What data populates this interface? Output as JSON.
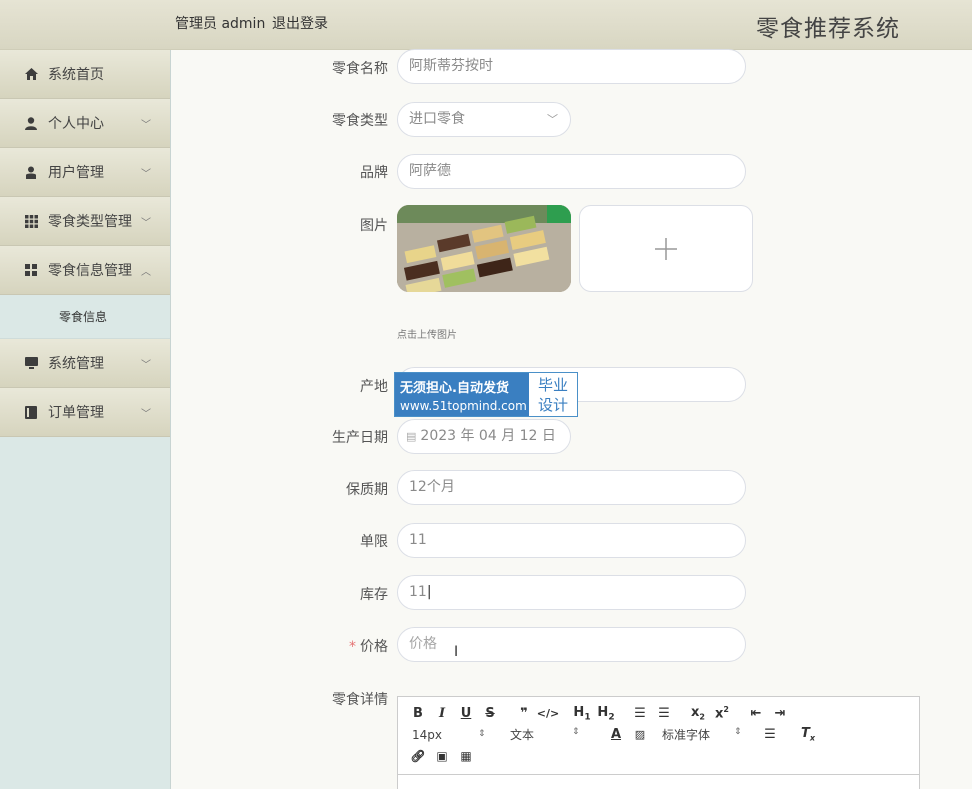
{
  "header": {
    "user_text": "管理员 admin",
    "logout_label": "退出登录",
    "system_title": "零食推荐系统"
  },
  "sidebar": {
    "items": [
      {
        "label": "系统首页",
        "icon": "home-icon"
      },
      {
        "label": "个人中心",
        "icon": "user-icon"
      },
      {
        "label": "用户管理",
        "icon": "user-manage-icon"
      },
      {
        "label": "零食类型管理",
        "icon": "grid-icon"
      },
      {
        "label": "零食信息管理",
        "icon": "grid2-icon"
      },
      {
        "label": "系统管理",
        "icon": "monitor-icon"
      },
      {
        "label": "订单管理",
        "icon": "book-icon"
      }
    ],
    "submenu_label": "零食信息"
  },
  "form": {
    "name_label": "零食名称",
    "name_value": "阿斯蒂芬按时",
    "type_label": "零食类型",
    "type_value": "进口零食",
    "brand_label": "品牌",
    "brand_value": "阿萨德",
    "image_label": "图片",
    "upload_tip": "点击上传图片",
    "origin_label": "产地",
    "date_label": "生产日期",
    "date_value": "2023 年 04 月 12 日",
    "shelf_label": "保质期",
    "shelf_value": "12个月",
    "limit_label": "单限",
    "limit_value": "11",
    "stock_label": "库存",
    "stock_value": "11",
    "price_required_mark": "*",
    "price_label": "价格",
    "price_placeholder": "价格",
    "detail_label": "零食详情"
  },
  "editor": {
    "font_size": "14px",
    "text_format": "文本",
    "font_family": "标准字体"
  },
  "watermark": {
    "line1": "无须担心.自动发货",
    "line2": "www.51topmind.com",
    "side1": "毕业",
    "side2": "设计"
  },
  "colors": {
    "header_bg": "#dcdac6",
    "sidebar_bg": "#dbe8e6",
    "required": "#e57373",
    "watermark_blue": "#3a7fc1"
  }
}
